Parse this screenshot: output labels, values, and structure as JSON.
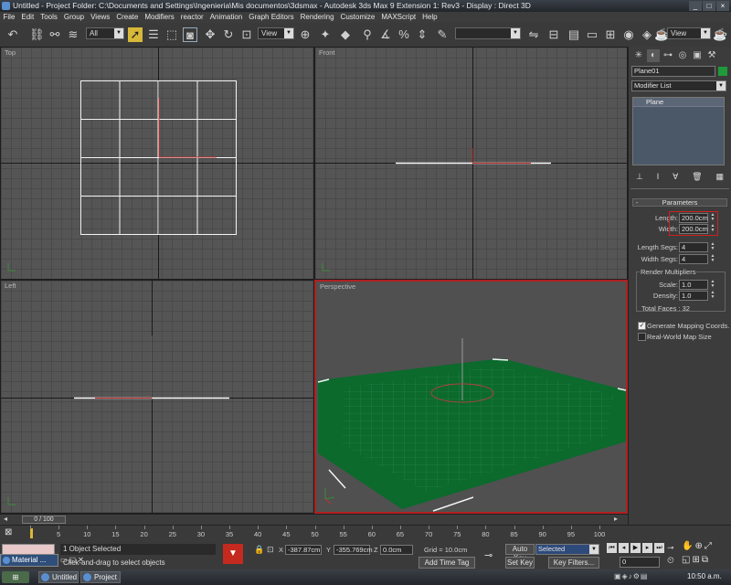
{
  "window": {
    "title": "Untitled    - Project Folder: C:\\Documents and Settings\\Ingenieria\\Mis documentos\\3dsmax    - Autodesk 3ds Max 9 Extension 1: Rev3    - Display : Direct 3D"
  },
  "menu": [
    "File",
    "Edit",
    "Tools",
    "Group",
    "Views",
    "Create",
    "Modifiers",
    "reactor",
    "Animation",
    "Graph Editors",
    "Rendering",
    "Customize",
    "MAXScript",
    "Help"
  ],
  "toolbar": {
    "selection_filter": "All",
    "ref_coord": "View",
    "ref_coord_right": "View"
  },
  "viewports": {
    "top": "Top",
    "front": "Front",
    "left": "Left",
    "perspective": "Perspective"
  },
  "command_panel": {
    "object_name": "Plane01",
    "object_color": "#1f9a3a",
    "modifier_list": "Modifier List",
    "stack_item": "Plane",
    "rollout_title": "Parameters",
    "length_label": "Length:",
    "length_value": "200.0cm",
    "width_label": "Width:",
    "width_value": "200.0cm",
    "length_segs_label": "Length Segs:",
    "length_segs_value": "4",
    "width_segs_label": "Width Segs:",
    "width_segs_value": "4",
    "render_mult_label": "Render Multipliers",
    "scale_label": "Scale:",
    "scale_value": "1.0",
    "density_label": "Density:",
    "density_value": "1.0",
    "total_faces": "Total Faces : 32",
    "gen_mapping_label": "Generate Mapping Coords.",
    "gen_mapping_checked": true,
    "real_world_label": "Real-World Map Size",
    "real_world_checked": false
  },
  "timeline": {
    "slider_text": "0 / 100",
    "ticks": [
      "5",
      "10",
      "15",
      "20",
      "25",
      "30",
      "35",
      "40",
      "45",
      "50",
      "55",
      "60",
      "65",
      "70",
      "75",
      "80",
      "85",
      "90",
      "95",
      "100"
    ]
  },
  "status": {
    "selection": "1 Object Selected",
    "prompt": "Click-and-drag to select objects",
    "x_value": "-387.87cm",
    "y_value": "-355.769cm",
    "z_value": "0.0cm",
    "grid": "Grid = 10.0cm",
    "add_time_tag": "Add Time Tag",
    "auto_key": "Auto Key",
    "set_key": "Set Key",
    "key_mode": "Selected",
    "key_filters": "Key Filters...",
    "frame": "0"
  },
  "taskbar": {
    "floating_title": "Material ...",
    "items": [
      "Untitled",
      "Project ..."
    ],
    "clock": "10:50 a.m."
  },
  "colors": {
    "plane_green": "#0b6a2c",
    "active_border": "#b02020",
    "select_highlight": "#d8b838"
  }
}
